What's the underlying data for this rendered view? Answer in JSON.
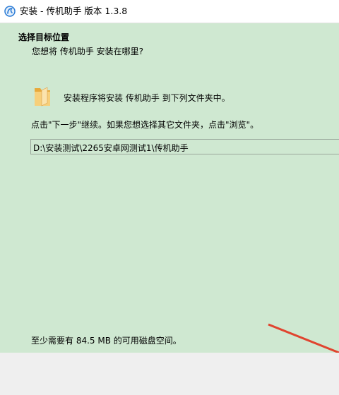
{
  "window": {
    "title": "安装 - 传机助手 版本 1.3.8"
  },
  "header": {
    "title": "选择目标位置",
    "subtitle": "您想将 传机助手 安装在哪里?"
  },
  "main": {
    "install_info": "安装程序将安装 传机助手 到下列文件夹中。",
    "instruction": "点击\"下一步\"继续。如果您想选择其它文件夹，点击\"浏览\"。",
    "path_value": "D:\\安装测试\\2265安卓网测试1\\传机助手",
    "space_requirement": "至少需要有 84.5 MB 的可用磁盘空间。"
  },
  "colors": {
    "background": "#cfe8d1",
    "arrow": "#e0442f",
    "folder": "#f4c46a"
  },
  "icons": {
    "app": "app-logo-icon",
    "folder": "folder-icon"
  }
}
